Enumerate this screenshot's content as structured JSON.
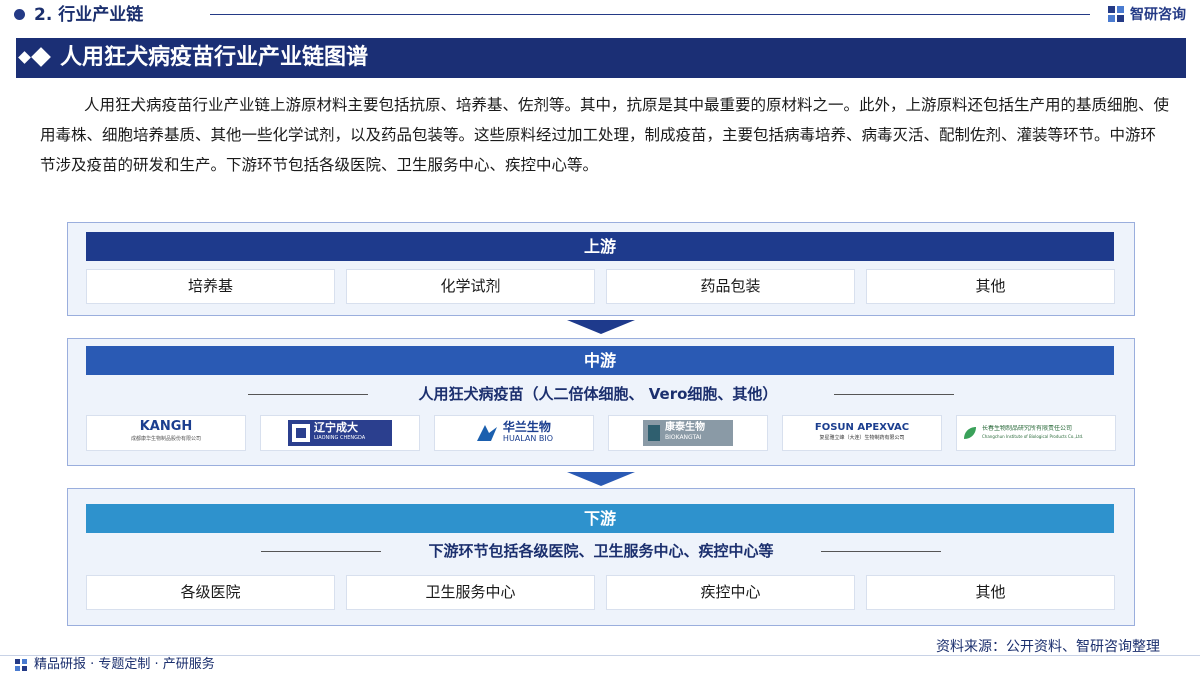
{
  "header": {
    "section_title": "2. 行业产业链",
    "brand": "智研咨询"
  },
  "banner": {
    "title": "人用狂犬病疫苗行业产业链图谱"
  },
  "intro": "人用狂犬病疫苗行业产业链上游原材料主要包括抗原、培养基、佐剂等。其中，抗原是其中最重要的原材料之一。此外，上游原料还包括生产用的基质细胞、使用毒株、细胞培养基质、其他一些化学试剂，以及药品包装等。这些原料经过加工处理，制成疫苗，主要包括病毒培养、病毒灭活、配制佐剂、灌装等环节。中游环节涉及疫苗的研发和生产。下游环节包括各级医院、卫生服务中心、疾控中心等。",
  "upstream": {
    "title": "上游",
    "items": [
      "培养基",
      "化学试剂",
      "药品包装",
      "其他"
    ]
  },
  "midstream": {
    "title": "中游",
    "subtitle": "人用狂犬病疫苗（人二倍体细胞、 Vero细胞、其他）",
    "logos": [
      {
        "name": "KANGH",
        "sub": "成都康华生物制品股份有限公司"
      },
      {
        "name": "辽宁成大",
        "sub": "LIAONING CHENGDA"
      },
      {
        "name": "华兰生物",
        "sub": "HUALAN BIO"
      },
      {
        "name": "康泰生物",
        "sub": "BIOKANGTAI"
      },
      {
        "name": "FOSUN APEXVAC",
        "sub": "复星雅立峰（大连）生物制药有限公司"
      },
      {
        "name": "长春生物制品研究所有限责任公司",
        "sub": "Changchun Institute of Biological Products Co.,Ltd."
      }
    ]
  },
  "downstream": {
    "title": "下游",
    "subtitle": "下游环节包括各级医院、卫生服务中心、疾控中心等",
    "items": [
      "各级医院",
      "卫生服务中心",
      "疾控中心",
      "其他"
    ]
  },
  "footer": {
    "source": "资料来源：公开资料、智研咨询整理",
    "services": "精品研报 · 专题定制 · 产研服务"
  },
  "colors": {
    "navy": "#1b2f75",
    "upstream_head": "#1e3a8c",
    "midstream_head": "#2a5ab4",
    "downstream_head": "#2e92cd"
  }
}
